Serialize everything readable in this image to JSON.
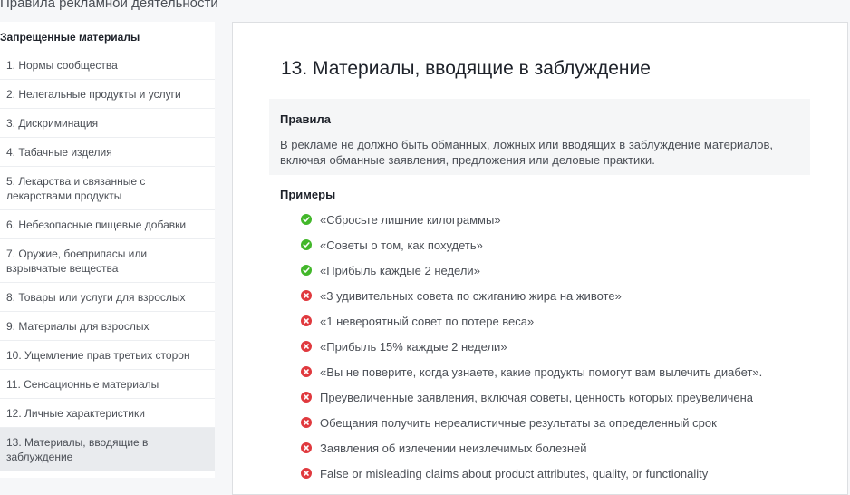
{
  "page_title": "Правила рекламной деятельности",
  "colors": {
    "ok": "#42b72a",
    "bad": "#e0393e"
  },
  "sidebar": {
    "heading": "Запрещенные материалы",
    "items": [
      {
        "label": "1. Нормы сообщества"
      },
      {
        "label": "2. Нелегальные продукты и услуги"
      },
      {
        "label": "3. Дискриминация"
      },
      {
        "label": "4. Табачные изделия"
      },
      {
        "label": "5. Лекарства и связанные с лекарствами продукты"
      },
      {
        "label": "6. Небезопасные пищевые добавки"
      },
      {
        "label": "7. Оружие, боеприпасы или взрывчатые вещества"
      },
      {
        "label": "8. Товары или услуги для взрослых"
      },
      {
        "label": "9. Материалы для взрослых"
      },
      {
        "label": "10. Ущемление прав третьих сторон"
      },
      {
        "label": "11. Сенсационные материалы"
      },
      {
        "label": "12. Личные характеристики"
      },
      {
        "label": "13. Материалы, вводящие в заблуждение",
        "active": true
      }
    ]
  },
  "content": {
    "title": "13. Материалы, вводящие в заблуждение",
    "rules_heading": "Правила",
    "rules_text": "В рекламе не должно быть обманных, ложных или вводящих в заблуждение материалов, включая обманные заявления, предложения или деловые практики.",
    "examples_heading": "Примеры",
    "examples": [
      {
        "icon": "check-icon",
        "text": "«Сбросьте лишние килограммы»"
      },
      {
        "icon": "check-icon",
        "text": "«Советы о том, как похудеть»"
      },
      {
        "icon": "check-icon",
        "text": "«Прибыль каждые 2 недели»"
      },
      {
        "icon": "cross-icon",
        "text": "«3 удивительных совета по сжиганию жира на животе»"
      },
      {
        "icon": "cross-icon",
        "text": "«1 невероятный совет по потере веса»"
      },
      {
        "icon": "cross-icon",
        "text": "«Прибыль 15% каждые 2 недели»"
      },
      {
        "icon": "cross-icon",
        "text": "«Вы не поверите, когда узнаете, какие продукты помогут вам вылечить диабет»."
      },
      {
        "icon": "cross-icon",
        "text": "Преувеличенные заявления, включая советы, ценность которых преувеличена"
      },
      {
        "icon": "cross-icon",
        "text": "Обещания получить нереалистичные результаты за определенный срок"
      },
      {
        "icon": "cross-icon",
        "text": "Заявления об излечении неизлечимых болезней"
      },
      {
        "icon": "cross-icon",
        "text": "False or misleading claims about product attributes, quality, or functionality"
      }
    ]
  }
}
